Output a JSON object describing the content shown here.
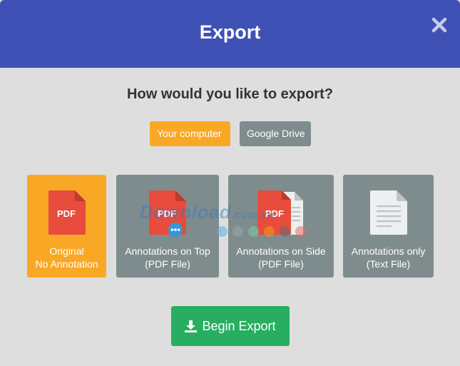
{
  "dialog": {
    "title": "Export",
    "question": "How would you like to export?"
  },
  "destinations": [
    {
      "label": "Your computer",
      "selected": true
    },
    {
      "label": "Google Drive",
      "selected": false
    }
  ],
  "formats": [
    {
      "line1": "Original",
      "line2": "No Annotation",
      "selected": true,
      "icon": "pdf-icon"
    },
    {
      "line1": "Annotations on Top",
      "line2": "(PDF File)",
      "selected": false,
      "icon": "pdf-comment-icon"
    },
    {
      "line1": "Annotations on Side",
      "line2": "(PDF File)",
      "selected": false,
      "icon": "pdf-side-icon"
    },
    {
      "line1": "Annotations only",
      "line2": "(Text File)",
      "selected": false,
      "icon": "text-file-icon"
    }
  ],
  "icon_text": "PDF",
  "begin_export": {
    "label": "Begin Export",
    "icon": "download-icon"
  },
  "watermark": {
    "text": "Download",
    "suffix": ".com.vn"
  },
  "colors": {
    "header": "#3f51b5",
    "selected": "#f9a825",
    "unselected": "#7f8c8d",
    "begin": "#27ae60",
    "pdf_red": "#e74c3c"
  }
}
